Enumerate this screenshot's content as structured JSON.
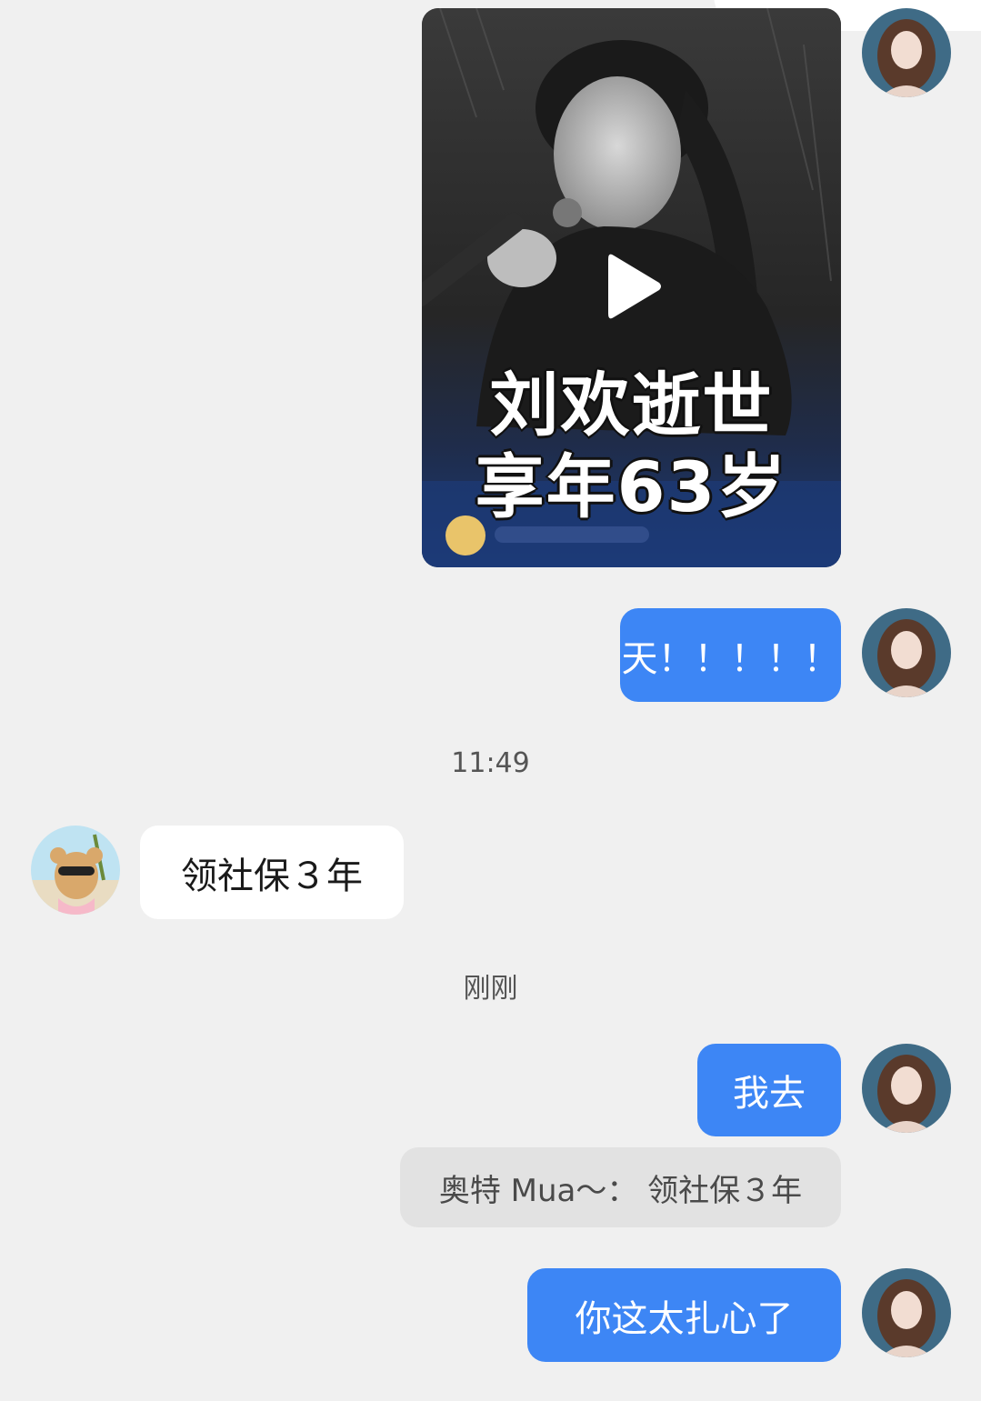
{
  "messages": {
    "video": {
      "caption_line1": "刘欢逝世",
      "caption_line2": "享年63岁"
    },
    "msg1": "天！！！！！",
    "time1": "11:49",
    "msg2": "领社保３年",
    "time2": "刚刚",
    "msg3": "我去",
    "quote": "奥特 Mua～：  领社保３年",
    "msg4": "你这太扎心了"
  },
  "colors": {
    "self_bubble": "#3d86f5",
    "other_bubble": "#ffffff",
    "background": "#f0f0f0",
    "quote_bubble": "#e2e2e2"
  },
  "icons": {
    "play": "play-icon"
  }
}
